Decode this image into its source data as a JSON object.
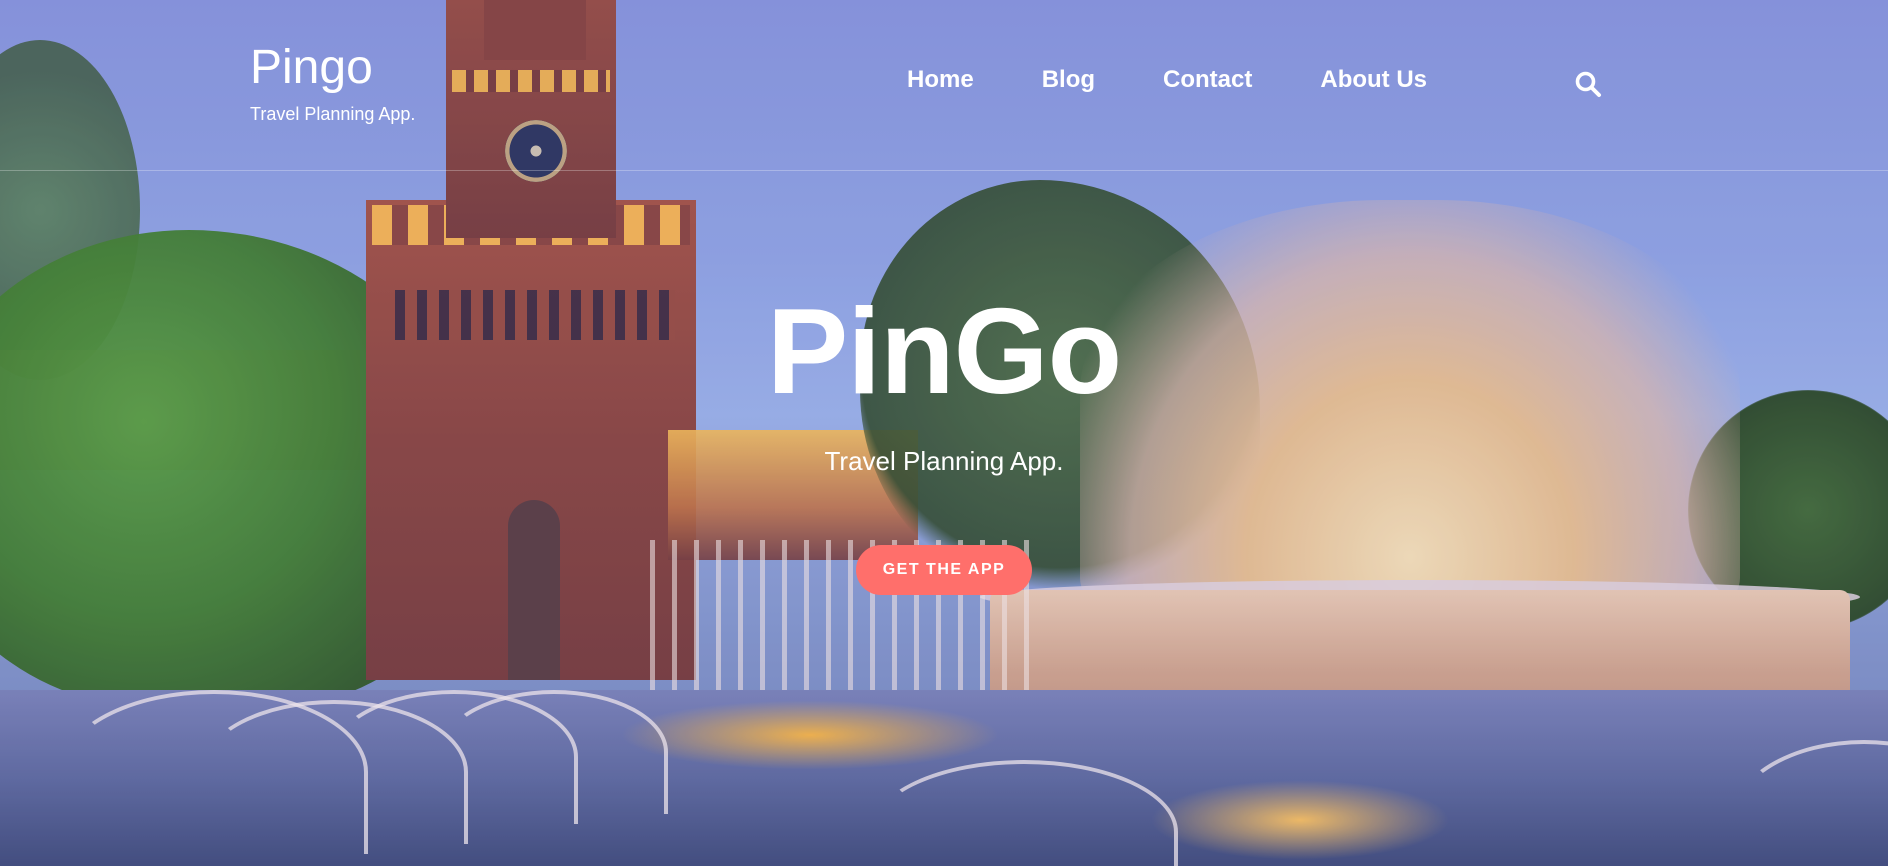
{
  "brand": {
    "title": "Pingo",
    "tagline": "Travel Planning App."
  },
  "nav": {
    "items": [
      {
        "label": "Home"
      },
      {
        "label": "Blog"
      },
      {
        "label": "Contact"
      },
      {
        "label": "About Us"
      }
    ],
    "search_icon": "search-icon"
  },
  "hero": {
    "title": "PinGo",
    "subtitle": "Travel Planning App.",
    "cta_label": "GET THE APP",
    "background": "castle-and-fountain-photo"
  },
  "colors": {
    "cta": "#ff6f6b",
    "text": "#ffffff",
    "sky": "#93a7e4"
  }
}
